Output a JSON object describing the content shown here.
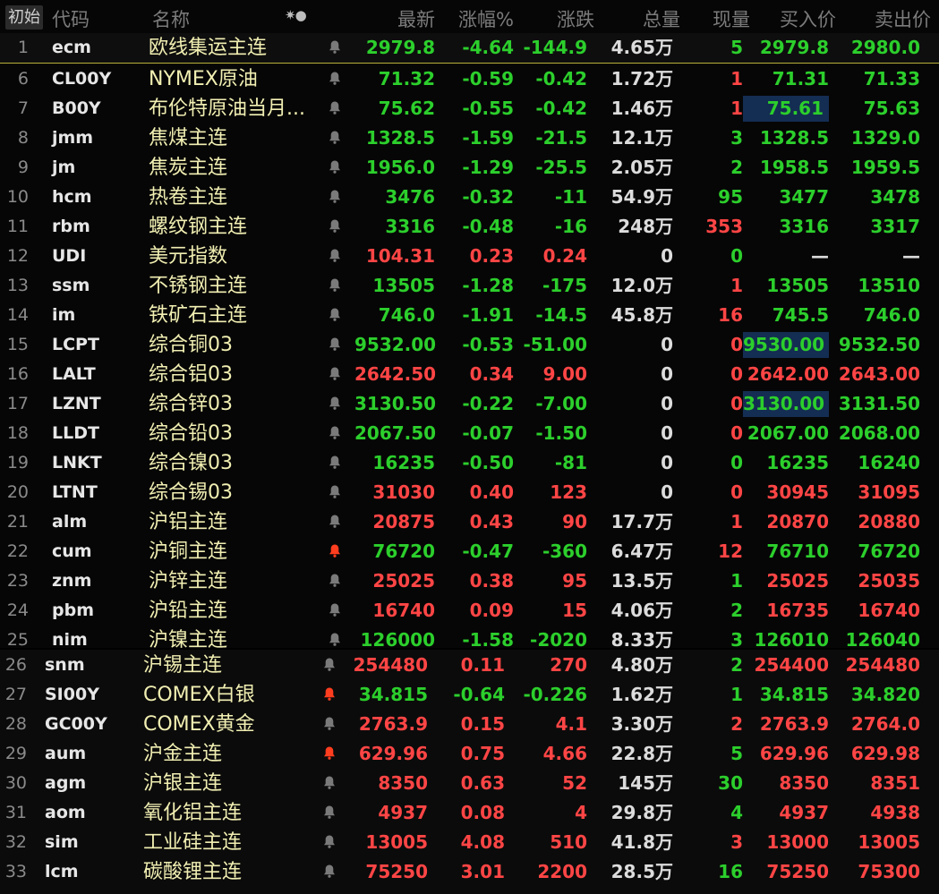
{
  "header": {
    "init_label": "初始",
    "cols": [
      "代码",
      "名称",
      "最新",
      "涨幅%",
      "涨跌",
      "总量",
      "现量",
      "买入价",
      "卖出价"
    ],
    "gear_glyph": "✷●"
  },
  "rows": [
    {
      "idx": "1",
      "code": "ecm",
      "name": "欧线集运主连",
      "price": "2979.8",
      "pct": "-4.64",
      "chg": "-144.9",
      "vol": "4.65万",
      "cur": "5",
      "bid": "2979.8",
      "ask": "2980.0",
      "dir": "dn",
      "cur_dir": "dn",
      "bell": "off"
    },
    {
      "idx": "6",
      "code": "CL00Y",
      "name": "NYMEX原油",
      "price": "71.32",
      "pct": "-0.59",
      "chg": "-0.42",
      "vol": "1.72万",
      "cur": "1",
      "bid": "71.31",
      "ask": "71.33",
      "dir": "dn",
      "cur_dir": "up",
      "bell": "off"
    },
    {
      "idx": "7",
      "code": "B00Y",
      "name": "布伦特原油当月...",
      "price": "75.62",
      "pct": "-0.55",
      "chg": "-0.42",
      "vol": "1.46万",
      "cur": "1",
      "bid": "75.61",
      "ask": "75.63",
      "dir": "dn",
      "cur_dir": "up",
      "bell": "off",
      "bid_hl": true
    },
    {
      "idx": "8",
      "code": "jmm",
      "name": "焦煤主连",
      "price": "1328.5",
      "pct": "-1.59",
      "chg": "-21.5",
      "vol": "12.1万",
      "cur": "3",
      "bid": "1328.5",
      "ask": "1329.0",
      "dir": "dn",
      "cur_dir": "dn",
      "bell": "off"
    },
    {
      "idx": "9",
      "code": "jm",
      "name": "焦炭主连",
      "price": "1956.0",
      "pct": "-1.29",
      "chg": "-25.5",
      "vol": "2.05万",
      "cur": "2",
      "bid": "1958.5",
      "ask": "1959.5",
      "dir": "dn",
      "cur_dir": "dn",
      "bell": "off"
    },
    {
      "idx": "10",
      "code": "hcm",
      "name": "热卷主连",
      "price": "3476",
      "pct": "-0.32",
      "chg": "-11",
      "vol": "54.9万",
      "cur": "95",
      "bid": "3477",
      "ask": "3478",
      "dir": "dn",
      "cur_dir": "dn",
      "bell": "off"
    },
    {
      "idx": "11",
      "code": "rbm",
      "name": "螺纹钢主连",
      "price": "3316",
      "pct": "-0.48",
      "chg": "-16",
      "vol": "248万",
      "cur": "353",
      "bid": "3316",
      "ask": "3317",
      "dir": "dn",
      "cur_dir": "up",
      "bell": "off"
    },
    {
      "idx": "12",
      "code": "UDI",
      "name": "美元指数",
      "price": "104.31",
      "pct": "0.23",
      "chg": "0.24",
      "vol": "0",
      "cur": "0",
      "bid": "—",
      "ask": "—",
      "dir": "up",
      "cur_dir": "dn",
      "bell": "off",
      "quote_dir": "neu"
    },
    {
      "idx": "13",
      "code": "ssm",
      "name": "不锈钢主连",
      "price": "13505",
      "pct": "-1.28",
      "chg": "-175",
      "vol": "12.0万",
      "cur": "1",
      "bid": "13505",
      "ask": "13510",
      "dir": "dn",
      "cur_dir": "up",
      "bell": "off"
    },
    {
      "idx": "14",
      "code": "im",
      "name": "铁矿石主连",
      "price": "746.0",
      "pct": "-1.91",
      "chg": "-14.5",
      "vol": "45.8万",
      "cur": "16",
      "bid": "745.5",
      "ask": "746.0",
      "dir": "dn",
      "cur_dir": "up",
      "bell": "off"
    },
    {
      "idx": "15",
      "code": "LCPT",
      "name": "综合铜03",
      "price": "9532.00",
      "pct": "-0.53",
      "chg": "-51.00",
      "vol": "0",
      "cur": "0",
      "bid": "9530.00",
      "ask": "9532.50",
      "dir": "dn",
      "cur_dir": "up",
      "bell": "off",
      "bid_hl": true
    },
    {
      "idx": "16",
      "code": "LALT",
      "name": "综合铝03",
      "price": "2642.50",
      "pct": "0.34",
      "chg": "9.00",
      "vol": "0",
      "cur": "0",
      "bid": "2642.00",
      "ask": "2643.00",
      "dir": "up",
      "cur_dir": "up",
      "bell": "off"
    },
    {
      "idx": "17",
      "code": "LZNT",
      "name": "综合锌03",
      "price": "3130.50",
      "pct": "-0.22",
      "chg": "-7.00",
      "vol": "0",
      "cur": "0",
      "bid": "3130.00",
      "ask": "3131.50",
      "dir": "dn",
      "cur_dir": "up",
      "bell": "off",
      "bid_hl": true
    },
    {
      "idx": "18",
      "code": "LLDT",
      "name": "综合铅03",
      "price": "2067.50",
      "pct": "-0.07",
      "chg": "-1.50",
      "vol": "0",
      "cur": "0",
      "bid": "2067.00",
      "ask": "2068.00",
      "dir": "dn",
      "cur_dir": "up",
      "bell": "off"
    },
    {
      "idx": "19",
      "code": "LNKT",
      "name": "综合镍03",
      "price": "16235",
      "pct": "-0.50",
      "chg": "-81",
      "vol": "0",
      "cur": "0",
      "bid": "16235",
      "ask": "16240",
      "dir": "dn",
      "cur_dir": "dn",
      "bell": "off"
    },
    {
      "idx": "20",
      "code": "LTNT",
      "name": "综合锡03",
      "price": "31030",
      "pct": "0.40",
      "chg": "123",
      "vol": "0",
      "cur": "0",
      "bid": "30945",
      "ask": "31095",
      "dir": "up",
      "cur_dir": "up",
      "bell": "off"
    },
    {
      "idx": "21",
      "code": "alm",
      "name": "沪铝主连",
      "price": "20875",
      "pct": "0.43",
      "chg": "90",
      "vol": "17.7万",
      "cur": "1",
      "bid": "20870",
      "ask": "20880",
      "dir": "up",
      "cur_dir": "up",
      "bell": "off"
    },
    {
      "idx": "22",
      "code": "cum",
      "name": "沪铜主连",
      "price": "76720",
      "pct": "-0.47",
      "chg": "-360",
      "vol": "6.47万",
      "cur": "12",
      "bid": "76710",
      "ask": "76720",
      "dir": "dn",
      "cur_dir": "up",
      "bell": "on"
    },
    {
      "idx": "23",
      "code": "znm",
      "name": "沪锌主连",
      "price": "25025",
      "pct": "0.38",
      "chg": "95",
      "vol": "13.5万",
      "cur": "1",
      "bid": "25025",
      "ask": "25035",
      "dir": "up",
      "cur_dir": "dn",
      "bell": "off"
    },
    {
      "idx": "24",
      "code": "pbm",
      "name": "沪铅主连",
      "price": "16740",
      "pct": "0.09",
      "chg": "15",
      "vol": "4.06万",
      "cur": "2",
      "bid": "16735",
      "ask": "16740",
      "dir": "up",
      "cur_dir": "dn",
      "bell": "off"
    },
    {
      "idx": "25",
      "code": "nim",
      "name": "沪镍主连",
      "price": "126000",
      "pct": "-1.58",
      "chg": "-2020",
      "vol": "8.33万",
      "cur": "3",
      "bid": "126010",
      "ask": "126040",
      "dir": "dn",
      "cur_dir": "dn",
      "bell": "off"
    }
  ],
  "rows2": [
    {
      "idx": "26",
      "code": "snm",
      "name": "沪锡主连",
      "price": "254480",
      "pct": "0.11",
      "chg": "270",
      "vol": "4.80万",
      "cur": "2",
      "bid": "254400",
      "ask": "254480",
      "dir": "up",
      "cur_dir": "dn",
      "bell": "off"
    },
    {
      "idx": "27",
      "code": "SI00Y",
      "name": "COMEX白银",
      "price": "34.815",
      "pct": "-0.64",
      "chg": "-0.226",
      "vol": "1.62万",
      "cur": "1",
      "bid": "34.815",
      "ask": "34.820",
      "dir": "dn",
      "cur_dir": "dn",
      "bell": "on"
    },
    {
      "idx": "28",
      "code": "GC00Y",
      "name": "COMEX黄金",
      "price": "2763.9",
      "pct": "0.15",
      "chg": "4.1",
      "vol": "3.30万",
      "cur": "2",
      "bid": "2763.9",
      "ask": "2764.0",
      "dir": "up",
      "cur_dir": "up",
      "bell": "off"
    },
    {
      "idx": "29",
      "code": "aum",
      "name": "沪金主连",
      "price": "629.96",
      "pct": "0.75",
      "chg": "4.66",
      "vol": "22.8万",
      "cur": "5",
      "bid": "629.96",
      "ask": "629.98",
      "dir": "up",
      "cur_dir": "dn",
      "bell": "on"
    },
    {
      "idx": "30",
      "code": "agm",
      "name": "沪银主连",
      "price": "8350",
      "pct": "0.63",
      "chg": "52",
      "vol": "145万",
      "cur": "30",
      "bid": "8350",
      "ask": "8351",
      "dir": "up",
      "cur_dir": "dn",
      "bell": "off"
    },
    {
      "idx": "31",
      "code": "aom",
      "name": "氧化铝主连",
      "price": "4937",
      "pct": "0.08",
      "chg": "4",
      "vol": "29.8万",
      "cur": "4",
      "bid": "4937",
      "ask": "4938",
      "dir": "up",
      "cur_dir": "dn",
      "bell": "off"
    },
    {
      "idx": "32",
      "code": "sim",
      "name": "工业硅主连",
      "price": "13005",
      "pct": "4.08",
      "chg": "510",
      "vol": "41.8万",
      "cur": "3",
      "bid": "13000",
      "ask": "13005",
      "dir": "up",
      "cur_dir": "up",
      "bell": "off"
    },
    {
      "idx": "33",
      "code": "lcm",
      "name": "碳酸锂主连",
      "price": "75250",
      "pct": "3.01",
      "chg": "2200",
      "vol": "28.5万",
      "cur": "16",
      "bid": "75250",
      "ask": "75300",
      "dir": "up",
      "cur_dir": "dn",
      "bell": "off"
    }
  ],
  "colors": {
    "up": "#ff4545",
    "down": "#2ccf2c",
    "name": "#f1efb2",
    "highlight": "#142d52",
    "bell_on": "#ff3d1f"
  }
}
